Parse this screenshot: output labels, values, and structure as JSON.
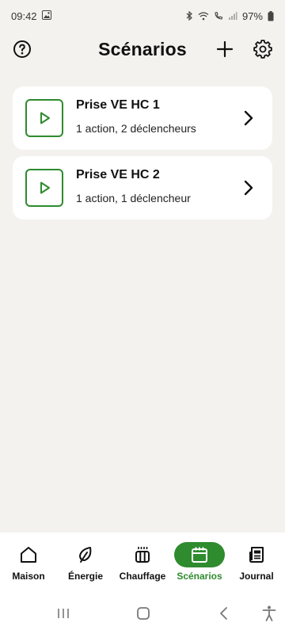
{
  "status": {
    "time": "09:42",
    "battery": "97%"
  },
  "header": {
    "title": "Scénarios"
  },
  "scenarios": [
    {
      "name": "Prise VE HC 1",
      "summary": "1 action, 2 déclencheurs"
    },
    {
      "name": "Prise VE HC 2",
      "summary": "1 action, 1 déclencheur"
    }
  ],
  "bottom_nav": {
    "items": [
      {
        "label": "Maison",
        "icon": "house-icon"
      },
      {
        "label": "Énergie",
        "icon": "leaf-icon"
      },
      {
        "label": "Chauffage",
        "icon": "radiator-icon"
      },
      {
        "label": "Scénarios",
        "icon": "calendar-icon",
        "active": true
      },
      {
        "label": "Journal",
        "icon": "newspaper-icon"
      }
    ]
  },
  "colors": {
    "accent": "#2e8b2e",
    "background": "#f4f2ee",
    "card": "#ffffff"
  }
}
